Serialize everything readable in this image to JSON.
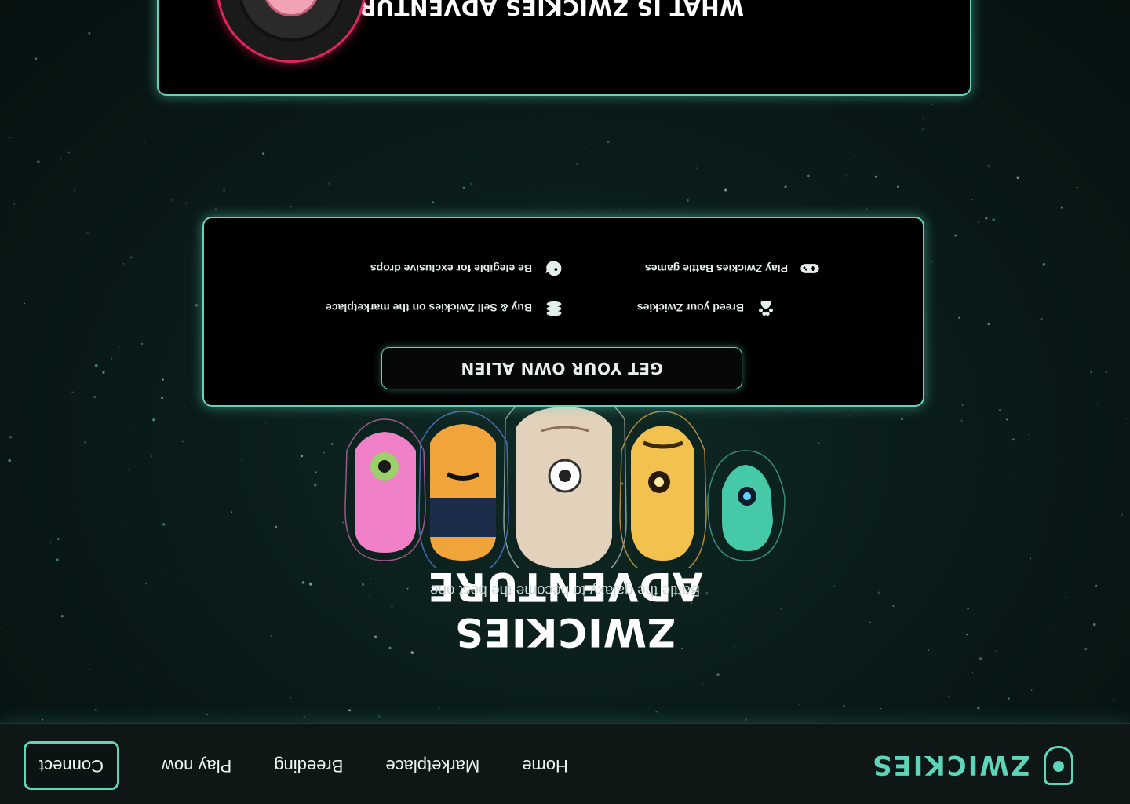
{
  "nav": {
    "logo_text": "ZWICKIES",
    "links": [
      "Home",
      "Marketplace",
      "Breeding",
      "Play now"
    ],
    "connect_label": "Connect"
  },
  "hero": {
    "title": "ZWICKIES ADVENTURE",
    "subtitle": "Battle the galaxy to become the best one"
  },
  "features": {
    "cta_label": "GET YOUR OWN ALIEN",
    "items": [
      {
        "label": "Be elegible for exclusive drops",
        "icon": "alien-head-icon"
      },
      {
        "label": "Play Zwickies Battle games",
        "icon": "gamepad-icon"
      },
      {
        "label": "Buy & Sell Zwickies on the marketplace",
        "icon": "coins-icon"
      },
      {
        "label": "Breed your Zwickies",
        "icon": "paw-icon"
      }
    ]
  },
  "about": {
    "title": "WHAT IS ZWICKIES ADVENTURE?"
  },
  "colors": {
    "accent": "#5ed4b8",
    "background": "#0a1c1a",
    "card": "#000000",
    "avatar_ring": "#e0245e"
  }
}
